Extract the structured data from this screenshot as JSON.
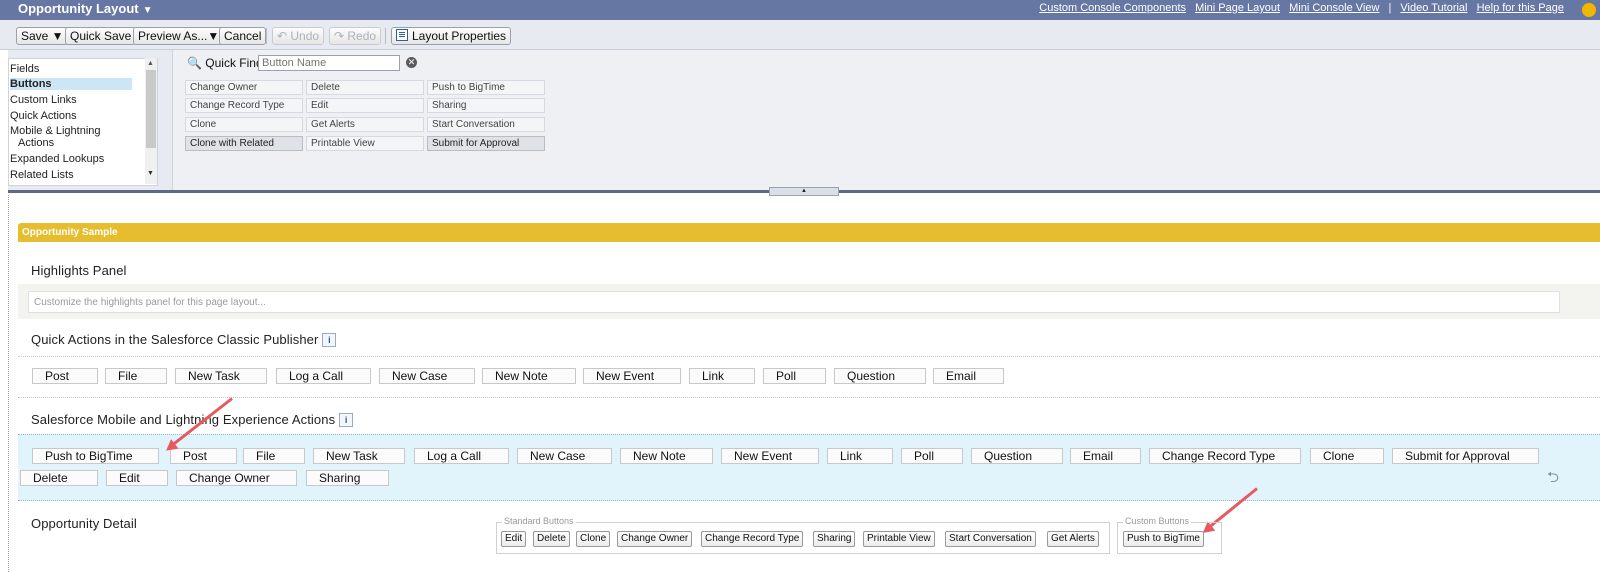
{
  "header": {
    "title": "Opportunity Layout",
    "links": [
      "Custom Console Components",
      "Mini Page Layout",
      "Mini Console View",
      "Video Tutorial",
      "Help for this Page"
    ],
    "separator": "|"
  },
  "toolbar": {
    "save": "Save ▼",
    "quick_save": "Quick Save",
    "preview_as": "Preview As...▼",
    "cancel": "Cancel",
    "undo": "↶ Undo",
    "redo": "↷ Redo",
    "layout_properties": "Layout Properties"
  },
  "palette": {
    "categories": [
      "Fields",
      "Buttons",
      "Custom Links",
      "Quick Actions",
      "Mobile & Lightning",
      "Actions",
      "Expanded Lookups",
      "Related Lists"
    ],
    "selected_category": "Buttons",
    "quick_find_label": "Quick Find",
    "quick_find_placeholder": "Button Name",
    "buttons": [
      [
        "Change Owner",
        "Delete",
        "Push to BigTime"
      ],
      [
        "Change Record Type",
        "Edit",
        "Sharing"
      ],
      [
        "Clone",
        "Get Alerts",
        "Start Conversation"
      ],
      [
        "Clone with Related",
        "Printable View",
        "Submit for Approval"
      ]
    ]
  },
  "layout": {
    "sample_title": "Opportunity Sample",
    "highlights_title": "Highlights Panel",
    "highlights_placeholder": "Customize the highlights panel for this page layout...",
    "quick_actions_title": "Quick Actions in the Salesforce Classic Publisher",
    "quick_actions": [
      "Post",
      "File",
      "New Task",
      "Log a Call",
      "New Case",
      "New Note",
      "New Event",
      "Link",
      "Poll",
      "Question",
      "Email"
    ],
    "mobile_title": "Salesforce Mobile and Lightning Experience Actions",
    "mobile_actions_row1": [
      "Push to BigTime",
      "Post",
      "File",
      "New Task",
      "Log a Call",
      "New Case",
      "New Note",
      "New Event",
      "Link",
      "Poll",
      "Question",
      "Email",
      "Change Record Type",
      "Clone",
      "Submit for Approval"
    ],
    "mobile_actions_row2": [
      "Delete",
      "Edit",
      "Change Owner",
      "Sharing"
    ],
    "detail_title": "Opportunity Detail",
    "standard_buttons_legend": "Standard Buttons",
    "standard_buttons": [
      "Edit",
      "Delete",
      "Clone",
      "Change Owner",
      "Change Record Type",
      "Sharing",
      "Printable View",
      "Start Conversation",
      "Get Alerts"
    ],
    "custom_buttons_legend": "Custom Buttons",
    "custom_buttons": [
      "Push to BigTime"
    ],
    "info_glyph": "i"
  },
  "colors": {
    "header_bg": "#6577a2",
    "sample_bar": "#e5bd2e",
    "mobile_bg": "#e2f4fb",
    "annotation_arrow": "#e8595f"
  }
}
